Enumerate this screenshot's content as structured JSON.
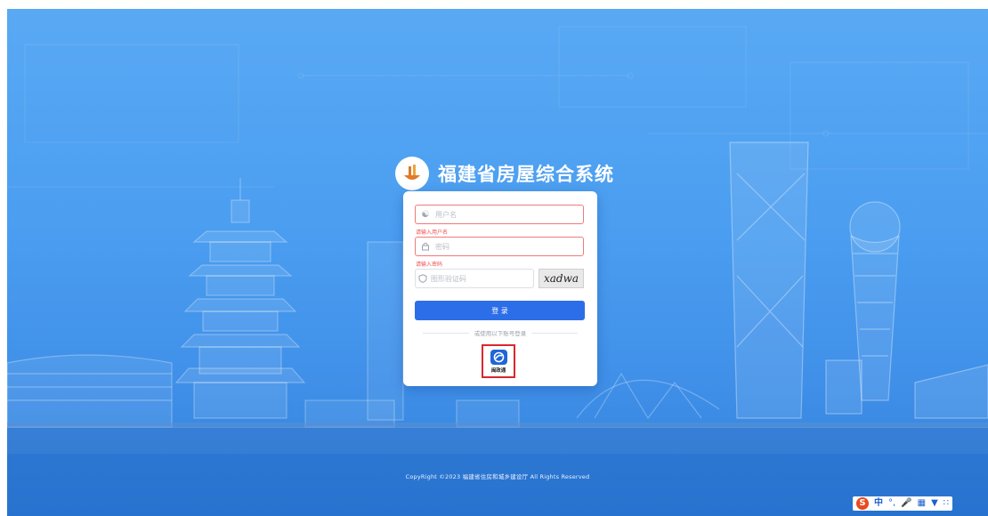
{
  "page": {
    "title": "福建省房屋综合系统"
  },
  "form": {
    "username_placeholder": "用户名",
    "username_error": "请输入用户名",
    "password_placeholder": "密码",
    "password_error": "请输入密码",
    "captcha_placeholder": "图形验证码",
    "captcha_text": "xadwa",
    "login_label": "登 录",
    "divider_text": "或使用以下账号登录",
    "alt_login_label": "闽政通"
  },
  "footer": {
    "copyright": "CopyRight ©2023 福建省住房和城乡建设厅 All Rights Reserved"
  },
  "ime": {
    "logo": "S",
    "lang": "中",
    "punct": "°,",
    "mic_icon": "microphone-icon",
    "keyboard_icon": "keyboard-icon",
    "skin_icon": "shirt-icon",
    "menu_icon": "grid-icon"
  },
  "colors": {
    "primary": "#2c6ee8",
    "error": "#f05050",
    "highlight": "#d8282d",
    "background": "#4a9df0"
  }
}
